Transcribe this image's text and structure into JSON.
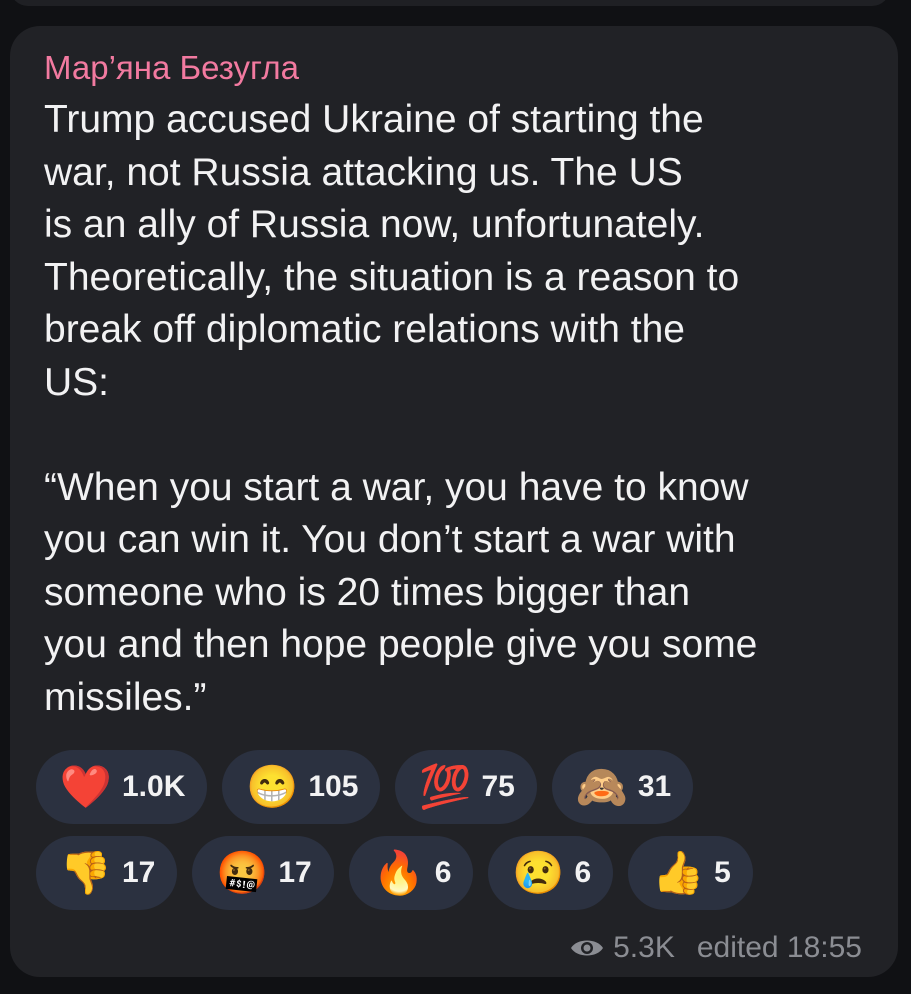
{
  "message": {
    "author": "Мар’яна Безугла",
    "text": "Trump accused Ukraine of starting the\nwar, not Russia attacking us. The US\nis an ally of Russia now, unfortunately.\nTheoretically, the situation is a reason to\nbreak off diplomatic relations with the\nUS:\n\n“When you start a war, you have to know\nyou can win it. You don’t start a war with\nsomeone who is 20 times bigger than\nyou and then hope people give you some\nmissiles.”",
    "views": "5.3K",
    "edited": "edited 18:55"
  },
  "reactions": {
    "row1": [
      {
        "icon": "red-heart-icon",
        "emoji": "❤️",
        "count": "1.0K"
      },
      {
        "icon": "grinning-face-icon",
        "emoji": "😁",
        "count": "105"
      },
      {
        "icon": "hundred-points-icon",
        "emoji": "💯",
        "count": "75"
      },
      {
        "icon": "see-no-evil-monkey-icon",
        "emoji": "🙈",
        "count": "31"
      }
    ],
    "row2": [
      {
        "icon": "thumbs-down-icon",
        "emoji": "👎",
        "count": "17"
      },
      {
        "icon": "face-with-symbols-icon",
        "emoji": "🤬",
        "count": "17"
      },
      {
        "icon": "fire-icon",
        "emoji": "🔥",
        "count": "6"
      },
      {
        "icon": "crying-face-icon",
        "emoji": "😢",
        "count": "6"
      },
      {
        "icon": "thumbs-up-icon",
        "emoji": "👍",
        "count": "5"
      }
    ]
  },
  "colors": {
    "background": "#101114",
    "bubble": "#212226",
    "author": "#f27aa0",
    "reaction_chip": "#2b3140",
    "meta_text": "#8b8d93"
  }
}
